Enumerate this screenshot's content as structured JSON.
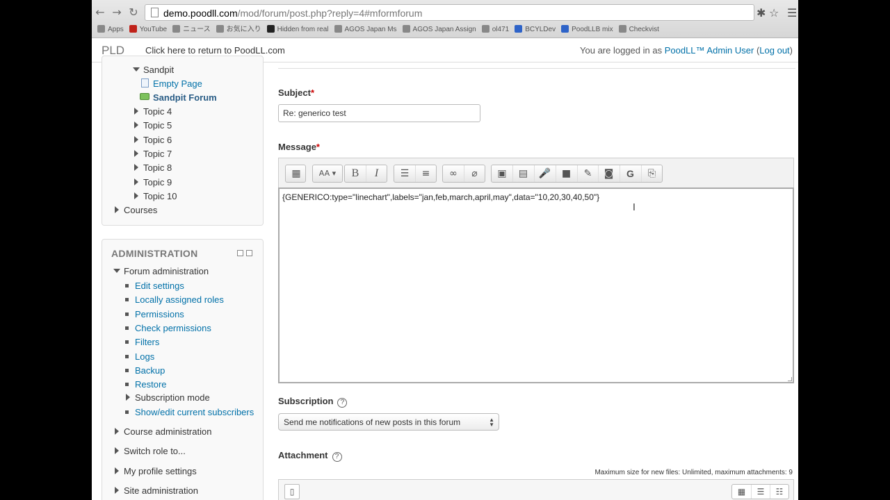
{
  "browser": {
    "url_host": "demo.poodll.com",
    "url_path": "/mod/forum/post.php?reply=4#mformforum",
    "bookmarks": [
      {
        "label": "Apps",
        "kind": "apps"
      },
      {
        "label": "YouTube",
        "kind": "yt"
      },
      {
        "label": "ニュース",
        "kind": "folder"
      },
      {
        "label": "お気に入り",
        "kind": "folder"
      },
      {
        "label": "Hidden from real",
        "kind": "m"
      },
      {
        "label": "AGOS Japan Ms",
        "kind": "doc"
      },
      {
        "label": "AGOS Japan Assign",
        "kind": "doc"
      },
      {
        "label": "ol471",
        "kind": "doc"
      },
      {
        "label": "BCYLDev",
        "kind": "bg"
      },
      {
        "label": "PoodLLB mix",
        "kind": "bg"
      },
      {
        "label": "Checkvist",
        "kind": "doc"
      }
    ]
  },
  "header": {
    "logo": "PLD",
    "return_link": "Click here to return to PoodLL.com",
    "logged_in_prefix": "You are logged in as ",
    "user_name": "PoodLL™ Admin User",
    "logout": "Log out"
  },
  "nav": {
    "sandpit": "Sandpit",
    "empty_page": "Empty Page",
    "sandpit_forum": "Sandpit Forum",
    "topics": [
      "Topic 4",
      "Topic 5",
      "Topic 6",
      "Topic 7",
      "Topic 8",
      "Topic 9",
      "Topic 10"
    ],
    "courses": "Courses"
  },
  "admin": {
    "title": "ADMINISTRATION",
    "forum_admin": "Forum administration",
    "items": [
      "Edit settings",
      "Locally assigned roles",
      "Permissions",
      "Check permissions",
      "Filters",
      "Logs",
      "Backup",
      "Restore"
    ],
    "subscription_mode": "Subscription mode",
    "show_edit_subscribers": "Show/edit current subscribers",
    "course_admin": "Course administration",
    "switch_role": "Switch role to...",
    "profile_settings": "My profile settings",
    "site_admin": "Site administration"
  },
  "form": {
    "subject_label": "Subject",
    "required_marker": "*",
    "subject_value": "Re: generico test",
    "message_label": "Message",
    "message_text": "{GENERICO:type=\"linechart\",labels=\"jan,feb,march,april,may\",data=\"10,20,30,40,50\"}",
    "subscription_label": "Subscription",
    "subscription_value": "Send me notifications of new posts in this forum",
    "attachment_label": "Attachment",
    "max_size": "Maximum size for new files: Unlimited, maximum attachments: 9",
    "help_glyph": "?"
  },
  "toolbar": {
    "font_btn": "AA",
    "bold": "B",
    "italic": "I",
    "g_icon": "G"
  }
}
